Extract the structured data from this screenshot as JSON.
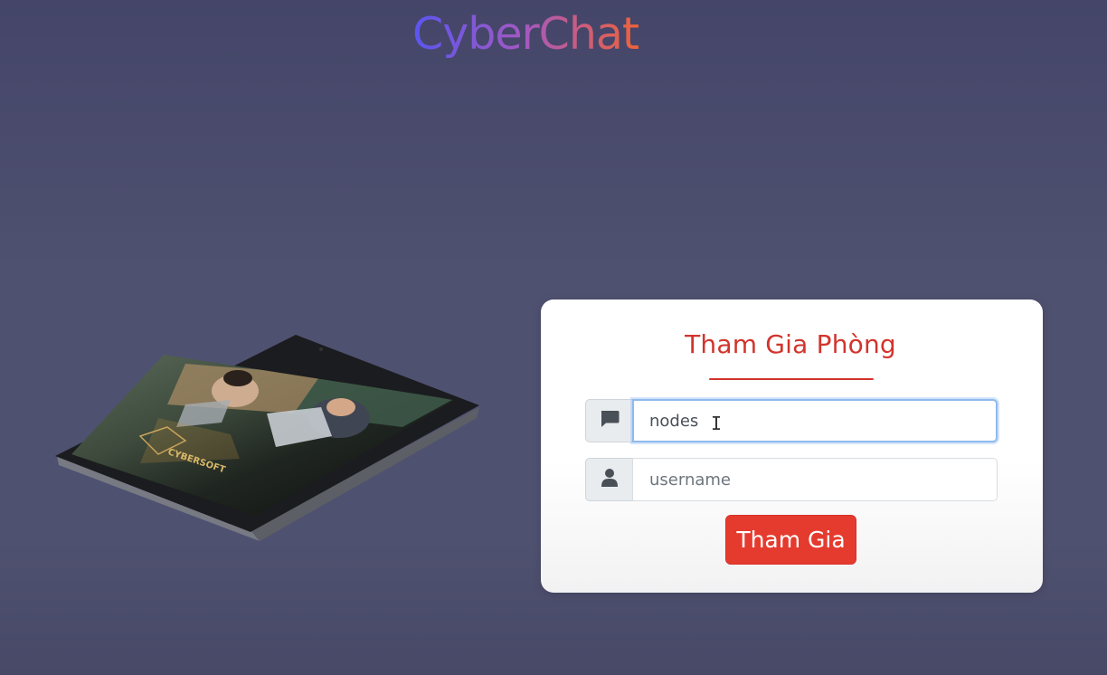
{
  "app": {
    "logo_text": "CyberChat",
    "brand_gradient": [
      "#5a56f0",
      "#a559c0",
      "#f0623a"
    ]
  },
  "device_image": {
    "subject": "tablet with photo of people at laptops",
    "logo_text": "CYBERSOFT"
  },
  "join_form": {
    "title": "Tham Gia Phòng",
    "room_field": {
      "icon": "message-icon",
      "value": "nodes",
      "focused": true
    },
    "username_field": {
      "icon": "user-icon",
      "placeholder": "username",
      "value": ""
    },
    "submit_label": "Tham Gia",
    "accent_color": "#d2342c",
    "button_color": "#e53b2e"
  }
}
